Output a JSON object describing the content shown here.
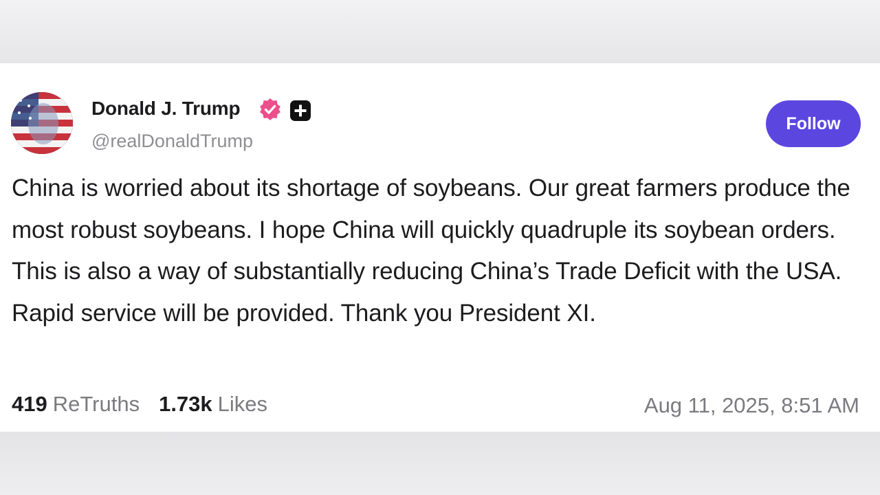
{
  "author": {
    "name": "Donald J. Trump",
    "handle": "@realDonaldTrump",
    "verified_icon": "verified-badge-icon",
    "verified_color": "#ec4f8c",
    "plus_icon": "plus-square-icon"
  },
  "follow": {
    "label": "Follow",
    "color": "#5b47e0"
  },
  "post": {
    "text": "China is worried about its shortage of soybeans. Our great farmers produce the most robust soybeans. I hope China will quickly quadruple its soybean orders. This is also a way of substantially reducing China’s Trade Deficit with the USA. Rapid service will be provided. Thank you President XI."
  },
  "stats": {
    "retruths_count": "419",
    "retruths_label": "ReTruths",
    "likes_count": "1.73k",
    "likes_label": "Likes",
    "timestamp": "Aug 11, 2025, 8:51 AM"
  }
}
